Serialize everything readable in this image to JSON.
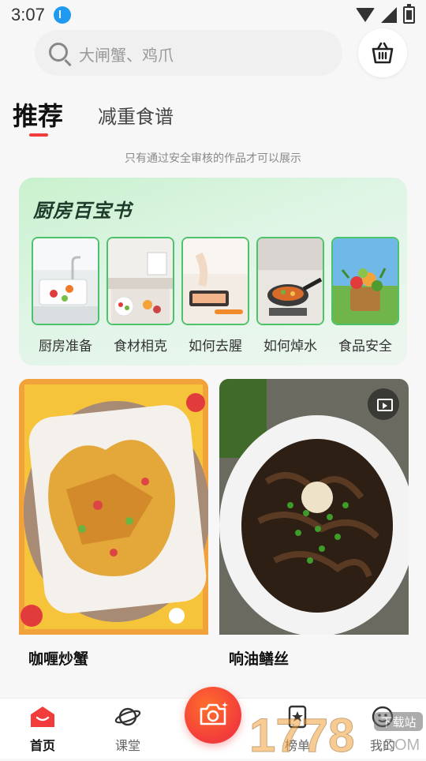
{
  "status_bar": {
    "time": "3:07"
  },
  "search": {
    "placeholder": "大闸蟹、鸡爪"
  },
  "tabs": [
    {
      "label": "推荐",
      "active": true
    },
    {
      "label": "减重食谱",
      "active": false
    }
  ],
  "notice": "只有通过安全审核的作品才可以展示",
  "kitchen": {
    "title": "厨房百宝书",
    "items": [
      {
        "label": "厨房准备"
      },
      {
        "label": "食材相克"
      },
      {
        "label": "如何去腥"
      },
      {
        "label": "如何焯水"
      },
      {
        "label": "食品安全"
      }
    ]
  },
  "feed": [
    {
      "title": "咖喱炒蟹",
      "video": false
    },
    {
      "title": "响油鳝丝",
      "video": true
    }
  ],
  "bottom_nav": {
    "items": [
      {
        "label": "首页",
        "active": true
      },
      {
        "label": "课堂",
        "active": false
      },
      {
        "label": "榜单",
        "active": false
      },
      {
        "label": "我的",
        "active": false
      }
    ]
  },
  "watermark": {
    "text": "1778",
    "badge": "下载站",
    "suffix": ".COM"
  },
  "colors": {
    "accent": "#f23b3b",
    "green": "#4cc36b"
  }
}
